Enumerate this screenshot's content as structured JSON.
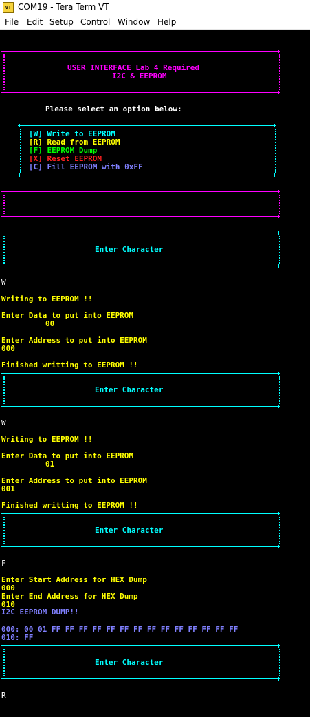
{
  "window": {
    "title": "COM19 - Tera Term VT",
    "icon_text": "VT"
  },
  "menu": [
    "File",
    "Edit",
    "Setup",
    "Control",
    "Window",
    "Help"
  ],
  "colors": {
    "yellow": "#ffff00",
    "cyan": "#00ffff",
    "magenta": "#ff00ff",
    "green": "#00ff00",
    "red": "#ff2020",
    "blue": "#8080ff",
    "background": "#000000"
  },
  "header": {
    "line1": "USER INTERFACE Lab 4 Required",
    "line2": "I2C & EEPROM"
  },
  "prompt": "Please select an option below:",
  "options": [
    {
      "text": "[W] Write to EEPROM",
      "color": "cyan"
    },
    {
      "text": "[R] Read from EEPROM",
      "color": "yellow"
    },
    {
      "text": "[F] EEPROM Dump",
      "color": "green"
    },
    {
      "text": "[X] Reset EEPROM",
      "color": "red"
    },
    {
      "text": "[C] Fill EEPROM with 0xFF",
      "color": "blue"
    }
  ],
  "enter_character": "Enter Character",
  "session": {
    "w1": {
      "input": "W",
      "writing": "Writing to EEPROM !!",
      "data_prompt": "Enter Data to put into EEPROM",
      "data_value": "00",
      "addr_prompt": "Enter Address to put into EEPROM",
      "addr_value": "000",
      "finished": "Finished writting to EEPROM !!"
    },
    "w2": {
      "input": "W",
      "writing": "Writing to EEPROM !!",
      "data_prompt": "Enter Data to put into EEPROM",
      "data_value": "01",
      "addr_prompt": "Enter Address to put into EEPROM",
      "addr_value": "001",
      "finished": "Finished writting to EEPROM !!"
    },
    "f": {
      "input": "F",
      "start_prompt": "Enter Start Address for HEX Dump",
      "start_value": "000",
      "end_prompt": "Enter End Address for HEX Dump",
      "end_value": "010",
      "dump_title": "I2C EEPROM DUMP!!",
      "dump_line1": "000: 00 01 FF FF FF FF FF FF FF FF FF FF FF FF FF FF",
      "dump_line2": "010: FF"
    },
    "last_input": "R"
  }
}
